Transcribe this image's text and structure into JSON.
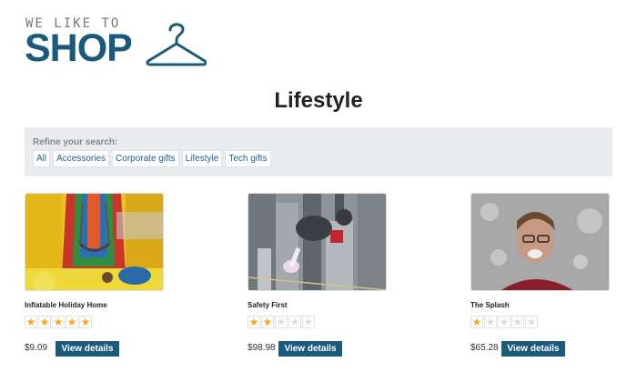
{
  "brand": {
    "small": "WE LIKE TO",
    "big": "SHOP"
  },
  "page": {
    "title": "Lifestyle"
  },
  "refine": {
    "label": "Refine your search:",
    "links": [
      "All",
      "Accessories",
      "Corporate gifts",
      "Lifestyle",
      "Tech gifts"
    ]
  },
  "products": [
    {
      "name": "Inflatable Holiday Home",
      "rating": 5,
      "price": "$9.09",
      "button": "View details",
      "image": "bouncy-castle-image"
    },
    {
      "name": "Safety First",
      "rating": 2,
      "price": "$98.98",
      "button": "View details",
      "image": "tightrope-city-image"
    },
    {
      "name": "The Splash",
      "rating": 1,
      "price": "$65.28",
      "button": "View details",
      "image": "water-splash-face-image"
    }
  ],
  "colors": {
    "brand": "#1c5a7d",
    "star": "#f5a623",
    "refine_bg": "#e9ecef"
  }
}
